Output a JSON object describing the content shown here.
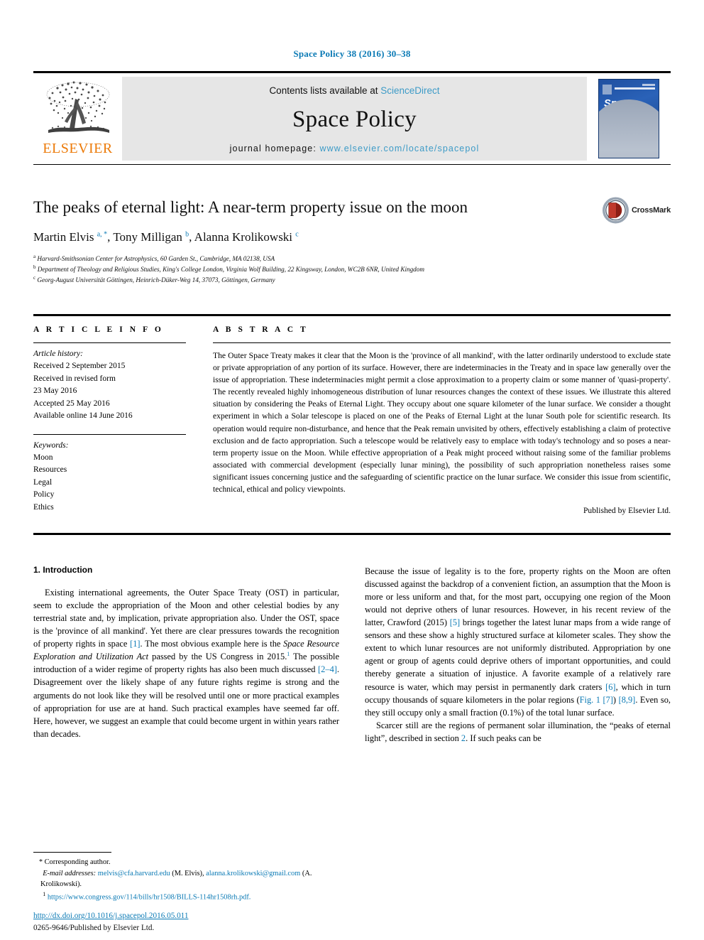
{
  "running_head": "Space Policy 38 (2016) 30–38",
  "masthead": {
    "publisher_name": "ELSEVIER",
    "contents_prefix": "Contents lists available at ",
    "contents_link": "ScienceDirect",
    "journal_name": "Space Policy",
    "homepage_prefix": "journal homepage: ",
    "homepage_url": "www.elsevier.com/locate/spacepol",
    "cover_title": "Space Policy"
  },
  "article": {
    "title": "The peaks of eternal light: A near-term property issue on the moon",
    "authors_html": "Martin Elvis <sup>a, *</sup>, Tony Milligan <sup>b</sup>, Alanna Krolikowski <sup>c</sup>",
    "affiliations": [
      "Harvard-Smithsonian Center for Astrophysics, 60 Garden St., Cambridge, MA 02138, USA",
      "Department of Theology and Religious Studies, King's College London, Virginia Wolf Building, 22 Kingsway, London, WC2B 6NR, United Kingdom",
      "Georg-August Universität Göttingen, Heinrich-Düker-Weg 14, 37073, Göttingen, Germany"
    ],
    "crossmark_label": "CrossMark"
  },
  "article_info": {
    "heading": "A R T I C L E  I N F O",
    "history_title": "Article history:",
    "history": [
      "Received 2 September 2015",
      "Received in revised form",
      "23 May 2016",
      "Accepted 25 May 2016",
      "Available online 14 June 2016"
    ],
    "keywords_title": "Keywords:",
    "keywords": [
      "Moon",
      "Resources",
      "Legal",
      "Policy",
      "Ethics"
    ]
  },
  "abstract": {
    "heading": "A B S T R A C T",
    "text": "The Outer Space Treaty makes it clear that the Moon is the 'province of all mankind', with the latter ordinarily understood to exclude state or private appropriation of any portion of its surface. However, there are indeterminacies in the Treaty and in space law generally over the issue of appropriation. These indeterminacies might permit a close approximation to a property claim or some manner of 'quasi-property'. The recently revealed highly inhomogeneous distribution of lunar resources changes the context of these issues. We illustrate this altered situation by considering the Peaks of Eternal Light. They occupy about one square kilometer of the lunar surface. We consider a thought experiment in which a Solar telescope is placed on one of the Peaks of Eternal Light at the lunar South pole for scientific research. Its operation would require non-disturbance, and hence that the Peak remain unvisited by others, effectively establishing a claim of protective exclusion and de facto appropriation. Such a telescope would be relatively easy to emplace with today's technology and so poses a near-term property issue on the Moon. While effective appropriation of a Peak might proceed without raising some of the familiar problems associated with commercial development (especially lunar mining), the possibility of such appropriation nonetheless raises some significant issues concerning justice and the safeguarding of scientific practice on the lunar surface. We consider this issue from scientific, technical, ethical and policy viewpoints.",
    "published_by": "Published by Elsevier Ltd."
  },
  "body": {
    "section_heading": "1. Introduction",
    "left_para_1_html": "Existing international agreements, the Outer Space Treaty (OST) in particular, seem to exclude the appropriation of the Moon and other celestial bodies by any terrestrial state and, by implication, private appropriation also. Under the OST, space is the 'province of all mankind'. Yet there are clear pressures towards the recognition of property rights in space <span class=\"ref\">[1]</span>. The most obvious example here is the <span class=\"ital\">Space Resource Exploration and Utilization Act</span> passed by the US Congress in 2015.<span class=\"sup-note\">1</span> The possible introduction of a wider regime of property rights has also been much discussed <span class=\"ref\">[2&#8211;4]</span>. Disagreement over the likely shape of any future rights regime is strong and the arguments do not look like they will be resolved until one or more practical examples of appropriation for use are at hand. Such practical examples have seemed far off. Here, however, we suggest an example that could become urgent in within years rather than decades.",
    "right_para_1_html": "Because the issue of legality is to the fore, property rights on the Moon are often discussed against the backdrop of a convenient fiction, an assumption that the Moon is more or less uniform and that, for the most part, occupying one region of the Moon would not deprive others of lunar resources. However, in his recent review of the latter, Crawford (2015) <span class=\"ref\">[5]</span> brings together the latest lunar maps from a wide range of sensors and these show a highly structured surface at kilometer scales. They show the extent to which lunar resources are not uniformly distributed. Appropriation by one agent or group of agents could deprive others of important opportunities, and could thereby generate a situation of injustice. A favorite example of a relatively rare resource is water, which may persist in permanently dark craters <span class=\"ref\">[6]</span>, which in turn occupy thousands of square kilometers in the polar regions (<span class=\"ref\">Fig. 1</span> <span class=\"ref\">[7]</span>) <span class=\"ref\">[8,9]</span>. Even so, they still occupy only a small fraction (0.1%) of the total lunar surface.",
    "right_para_2_html": "Scarcer still are the regions of permanent solar illumination, the “peaks of eternal light”, described in section <span class=\"ref\">2</span>. If such peaks can be"
  },
  "footnotes": {
    "corresponding": "Corresponding author.",
    "email_label": "E-mail addresses:",
    "email_1": "melvis@cfa.harvard.edu",
    "email_1_owner": "(M. Elvis),",
    "email_2": "alanna.krolikowski@gmail.com",
    "email_2_owner": "(A. Krolikowski).",
    "note_1_marker": "1",
    "note_1_url": "https://www.congress.gov/114/bills/hr1508/BILLS-114hr1508rh.pdf."
  },
  "bottom": {
    "doi": "http://dx.doi.org/10.1016/j.spacepol.2016.05.011",
    "issn": "0265-9646/Published by Elsevier Ltd."
  },
  "colors": {
    "link_blue": "#0b7ab5",
    "elsevier_orange": "#ec7a08",
    "masthead_gray": "#e6e6e6"
  }
}
